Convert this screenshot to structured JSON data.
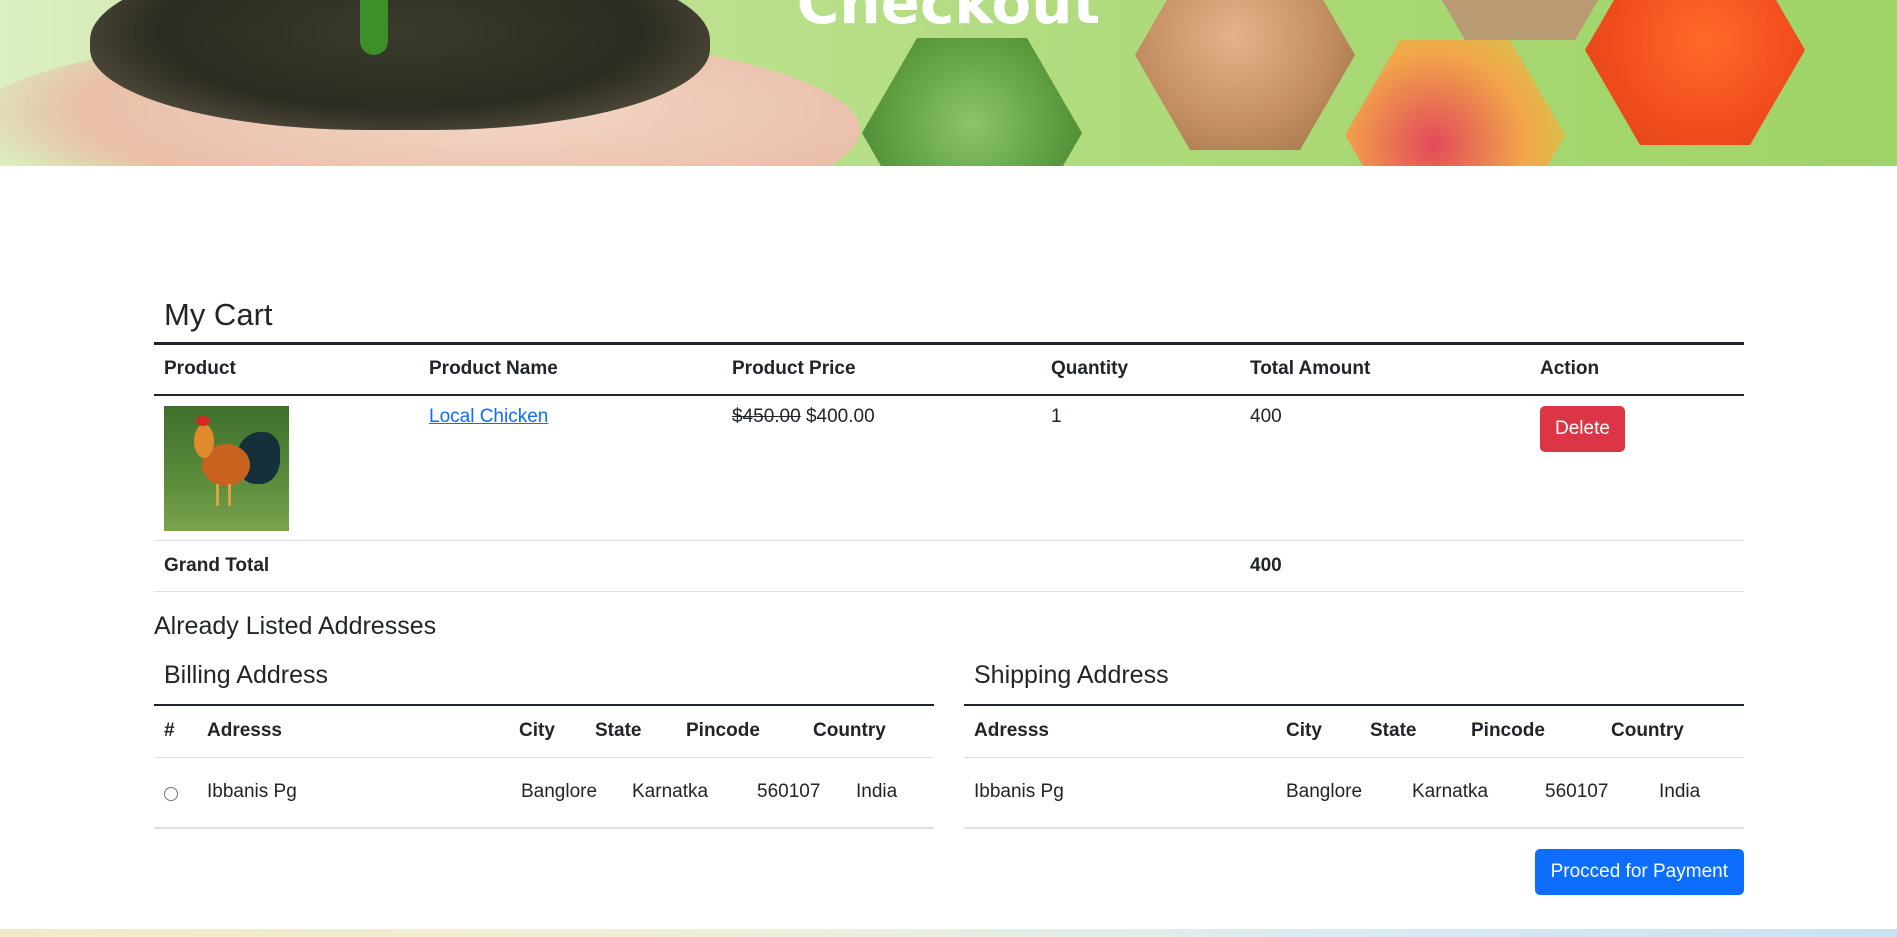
{
  "hero": {
    "title": "Checkout"
  },
  "cart": {
    "title": "My Cart",
    "columns": [
      "Product",
      "Product Name",
      "Product Price",
      "Quantity",
      "Total Amount",
      "Action"
    ],
    "items": [
      {
        "name": "Local Chicken",
        "old_price": "$450.00",
        "price": "$400.00",
        "quantity": "1",
        "total": "400",
        "action_label": "Delete"
      }
    ],
    "grand_total_label": "Grand Total",
    "grand_total_value": "400"
  },
  "addresses": {
    "heading": "Already Listed Addresses",
    "billing": {
      "title": "Billing Address",
      "columns": [
        "#",
        "Adresss",
        "City",
        "State",
        "Pincode",
        "Country"
      ],
      "rows": [
        {
          "address": "Ibbanis Pg",
          "city": "Banglore",
          "state": "Karnatka",
          "pincode": "560107",
          "country": "India"
        }
      ]
    },
    "shipping": {
      "title": "Shipping Address",
      "columns": [
        "Adresss",
        "City",
        "State",
        "Pincode",
        "Country"
      ],
      "rows": [
        {
          "address": "Ibbanis Pg",
          "city": "Banglore",
          "state": "Karnatka",
          "pincode": "560107",
          "country": "India"
        }
      ]
    }
  },
  "payment_button_label": "Procced for Payment",
  "colors": {
    "delete": "#dc3545",
    "primary": "#0d6efd",
    "link": "#0d6efd"
  }
}
